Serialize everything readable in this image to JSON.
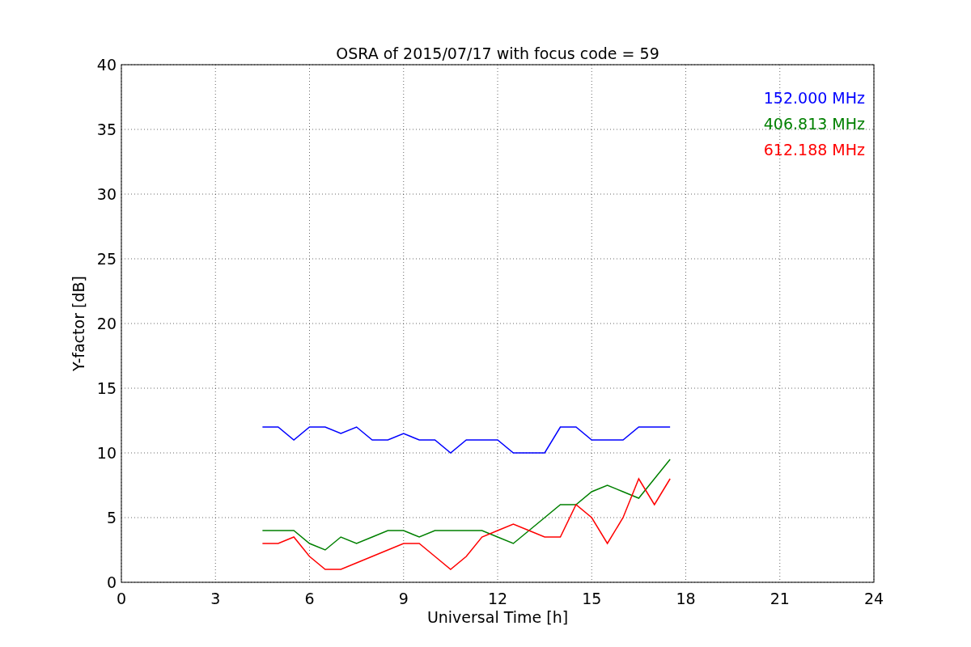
{
  "chart_data": {
    "type": "line",
    "title": "OSRA of 2015/07/17 with focus code = 59",
    "xlabel": "Universal Time [h]",
    "ylabel": "Y-factor [dB]",
    "x": [
      4.5,
      5,
      5.5,
      6,
      6.5,
      7,
      7.5,
      8,
      8.5,
      9,
      9.5,
      10,
      10.5,
      11,
      11.5,
      12,
      12.5,
      13,
      13.5,
      14,
      14.5,
      15,
      15.5,
      16,
      16.5,
      17,
      17.5
    ],
    "series": [
      {
        "name": "152.000 MHz",
        "color": "#0000ff",
        "values": [
          12,
          12,
          11,
          12,
          12,
          11.5,
          12,
          11,
          11,
          11.5,
          11,
          11,
          10,
          11,
          11,
          11,
          10,
          10,
          10,
          12,
          12,
          11,
          11,
          11,
          12,
          12,
          12
        ]
      },
      {
        "name": "406.813 MHz",
        "color": "#008000",
        "values": [
          4,
          4,
          4,
          3,
          2.5,
          3.5,
          3,
          3.5,
          4,
          4,
          3.5,
          4,
          4,
          4,
          4,
          3.5,
          3,
          4,
          5,
          6,
          6,
          7,
          7.5,
          7,
          6.5,
          8,
          9.5
        ]
      },
      {
        "name": "612.188 MHz",
        "color": "#ff0000",
        "values": [
          3,
          3,
          3.5,
          2,
          1,
          1,
          1.5,
          2,
          2.5,
          3,
          3,
          2,
          1,
          2,
          3.5,
          4,
          4.5,
          4,
          3.5,
          3.5,
          6,
          5,
          3,
          5,
          8,
          6,
          8
        ]
      }
    ],
    "xlim": [
      0,
      24
    ],
    "ylim": [
      0,
      40
    ],
    "xticks": [
      0,
      3,
      6,
      9,
      12,
      15,
      18,
      21,
      24
    ],
    "yticks": [
      0,
      5,
      10,
      15,
      20,
      25,
      30,
      35,
      40
    ],
    "grid": true
  }
}
